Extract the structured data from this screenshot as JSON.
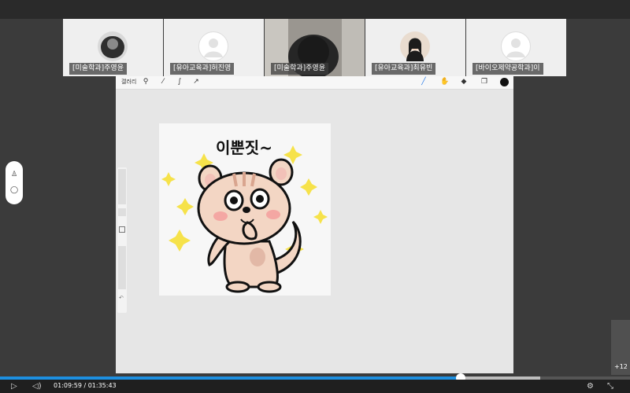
{
  "participants": [
    {
      "name": "[미술학과]주영윤",
      "avatar": "photo-dark"
    },
    {
      "name": "[유아교육과]허진영",
      "avatar": "placeholder"
    },
    {
      "name": "[미술학과]주영윤",
      "avatar": "camera-live"
    },
    {
      "name": "[유아교육과]최유빈",
      "avatar": "photo-portrait"
    },
    {
      "name": "[바이오제약공학과]이",
      "avatar": "placeholder"
    }
  ],
  "canvas_app": {
    "gallery_label": "갤러리",
    "tool_icons": [
      "wrench-icon",
      "magic-wand-icon",
      "selection-icon",
      "transform-arrow-icon"
    ],
    "right_tools": [
      "brush-icon",
      "smudge-icon",
      "eraser-icon",
      "layers-icon",
      "color-dot"
    ],
    "active_color": "#111111",
    "brush_color": "#2b7de9"
  },
  "sticker": {
    "text": "이뿐짓~"
  },
  "overflow_count": "+12",
  "player": {
    "current_time": "01:09:59",
    "separator": " / ",
    "total_time": "01:35:43",
    "progress": 0.731,
    "buffered": 0.857,
    "accent": "#1d8fe0"
  }
}
